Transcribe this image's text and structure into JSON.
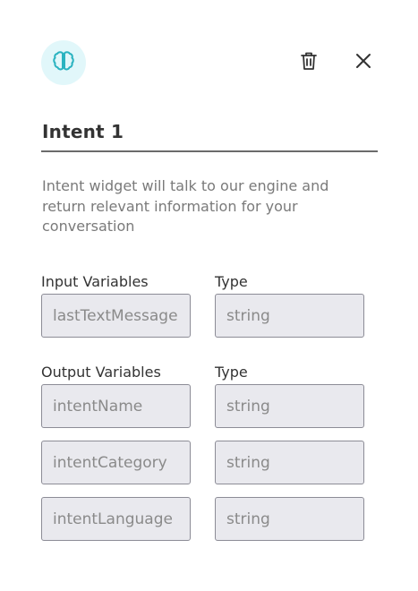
{
  "header": {
    "badge_icon": "brain-icon",
    "delete_icon": "trash-icon",
    "close_icon": "close-icon",
    "badge_color": "#e1f7fa",
    "accent_color": "#2ab3c0"
  },
  "title": "Intent 1",
  "description": "Intent widget will talk to our engine and return relevant information for your conversation",
  "input_section": {
    "variables_label": "Input Variables",
    "type_label": "Type",
    "rows": [
      {
        "name": "lastTextMessage",
        "type": "string"
      }
    ]
  },
  "output_section": {
    "variables_label": "Output Variables",
    "type_label": "Type",
    "rows": [
      {
        "name": "intentName",
        "type": "string"
      },
      {
        "name": "intentCategory",
        "type": "string"
      },
      {
        "name": "intentLanguage",
        "type": "string"
      }
    ]
  }
}
